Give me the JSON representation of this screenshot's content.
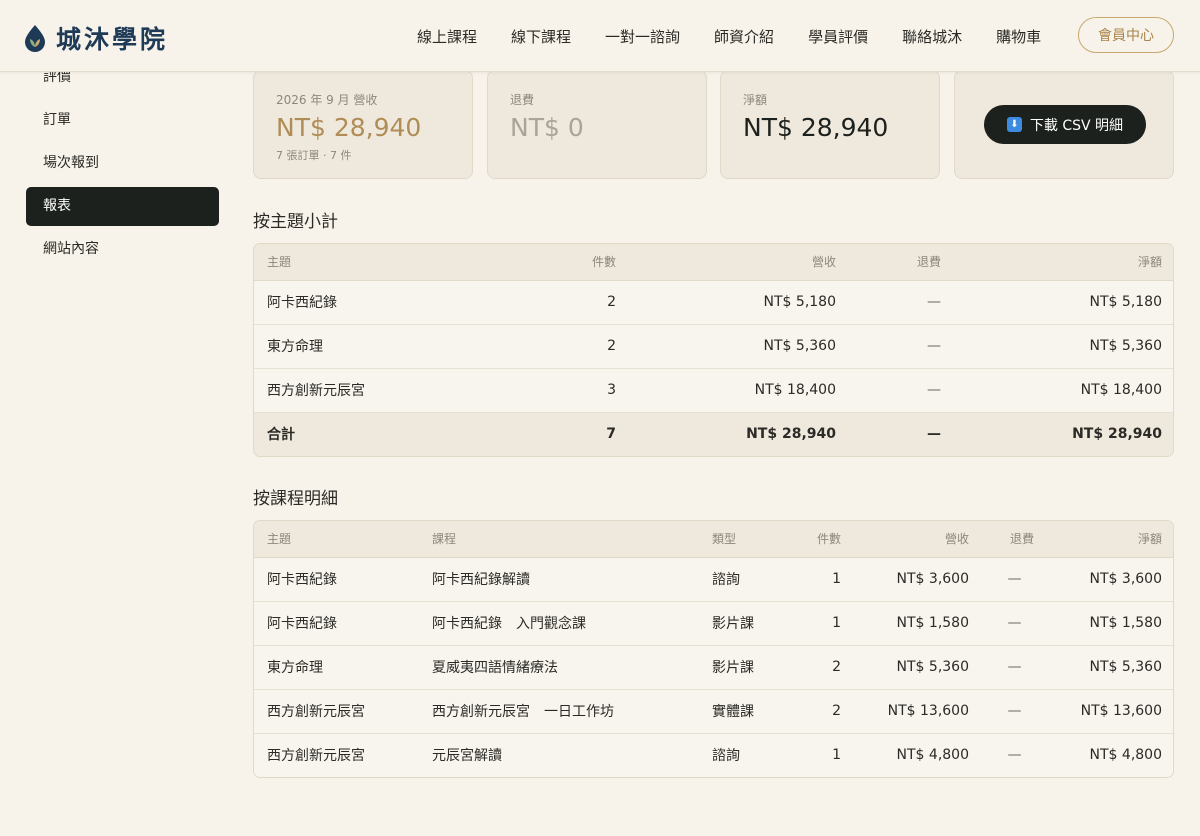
{
  "header": {
    "brand": "城沐學院",
    "nav": [
      "線上課程",
      "線下課程",
      "一對一諮詢",
      "師資介紹",
      "學員評價",
      "聯絡城沐",
      "購物車"
    ],
    "member_button": "會員中心"
  },
  "sidebar": {
    "items": [
      {
        "label": "評價"
      },
      {
        "label": "訂單"
      },
      {
        "label": "場次報到"
      },
      {
        "label": "報表",
        "active": true
      },
      {
        "label": "網站內容"
      }
    ]
  },
  "summary": {
    "revenue_label": "2026 年 9 月 營收",
    "revenue_value": "NT$ 28,940",
    "revenue_sub": "7 張訂單 · 7 件",
    "refund_label": "退費",
    "refund_value": "NT$ 0",
    "net_label": "淨額",
    "net_value": "NT$ 28,940",
    "csv_button": "下載 CSV 明細",
    "colors": {
      "revenue": "#b08d57",
      "refund": "#a9a497",
      "net": "#1d211d"
    }
  },
  "by_topic": {
    "title": "按主題小計",
    "headers": {
      "topic": "主題",
      "count": "件數",
      "revenue": "營收",
      "refund": "退費",
      "net": "淨額"
    },
    "rows": [
      {
        "topic": "阿卡西紀錄",
        "count": "2",
        "revenue": "NT$ 5,180",
        "refund": "—",
        "net": "NT$ 5,180"
      },
      {
        "topic": "東方命理",
        "count": "2",
        "revenue": "NT$ 5,360",
        "refund": "—",
        "net": "NT$ 5,360"
      },
      {
        "topic": "西方創新元辰宮",
        "count": "3",
        "revenue": "NT$ 18,400",
        "refund": "—",
        "net": "NT$ 18,400"
      }
    ],
    "total": {
      "topic": "合計",
      "count": "7",
      "revenue": "NT$ 28,940",
      "refund": "—",
      "net": "NT$ 28,940"
    }
  },
  "by_course": {
    "title": "按課程明細",
    "headers": {
      "topic": "主題",
      "course": "課程",
      "type": "類型",
      "count": "件數",
      "revenue": "營收",
      "refund": "退費",
      "net": "淨額"
    },
    "rows": [
      {
        "topic": "阿卡西紀錄",
        "course": "阿卡西紀錄解讀",
        "type": "諮詢",
        "count": "1",
        "revenue": "NT$ 3,600",
        "refund": "—",
        "net": "NT$ 3,600"
      },
      {
        "topic": "阿卡西紀錄",
        "course": "阿卡西紀錄　入門觀念課",
        "type": "影片課",
        "count": "1",
        "revenue": "NT$ 1,580",
        "refund": "—",
        "net": "NT$ 1,580"
      },
      {
        "topic": "東方命理",
        "course": "夏威夷四語情緒療法",
        "type": "影片課",
        "count": "2",
        "revenue": "NT$ 5,360",
        "refund": "—",
        "net": "NT$ 5,360"
      },
      {
        "topic": "西方創新元辰宮",
        "course": "西方創新元辰宮　一日工作坊",
        "type": "實體課",
        "count": "2",
        "revenue": "NT$ 13,600",
        "refund": "—",
        "net": "NT$ 13,600"
      },
      {
        "topic": "西方創新元辰宮",
        "course": "元辰宮解讀",
        "type": "諮詢",
        "count": "1",
        "revenue": "NT$ 4,800",
        "refund": "—",
        "net": "NT$ 4,800"
      }
    ]
  }
}
